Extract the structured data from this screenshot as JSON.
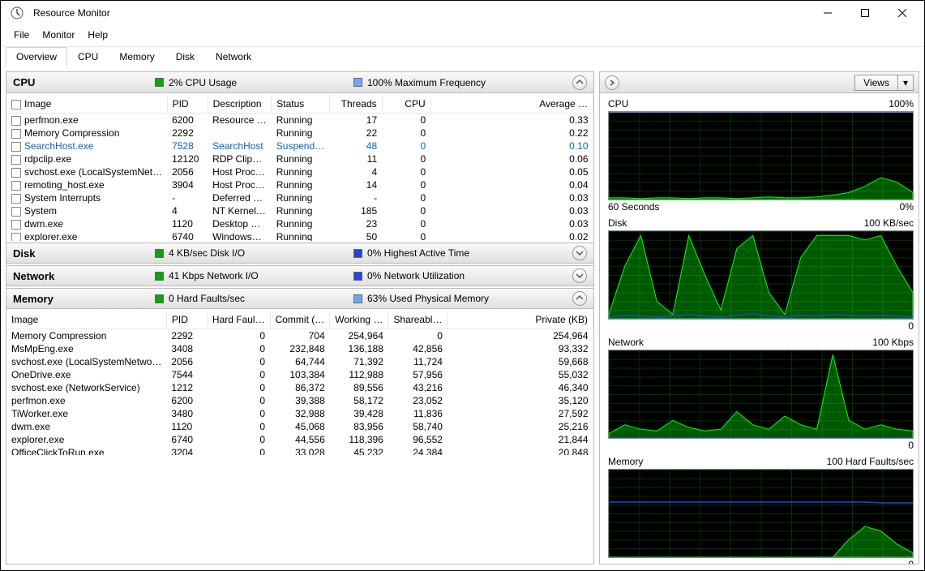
{
  "window": {
    "title": "Resource Monitor"
  },
  "menus": [
    "File",
    "Monitor",
    "Help"
  ],
  "tabs": [
    "Overview",
    "CPU",
    "Memory",
    "Disk",
    "Network"
  ],
  "active_tab": 0,
  "cpu_section": {
    "title": "CPU",
    "stat1": "2% CPU Usage",
    "stat1_color": "#00aa00",
    "stat2": "100% Maximum Frequency",
    "stat2_color": "#6aa8ff",
    "columns": [
      "Image",
      "PID",
      "Description",
      "Status",
      "Threads",
      "CPU",
      "Average …"
    ],
    "rows": [
      {
        "image": "perfmon.exe",
        "pid": "6200",
        "desc": "Resource …",
        "status": "Running",
        "threads": "17",
        "cpu": "0",
        "avg": "0.33"
      },
      {
        "image": "Memory Compression",
        "pid": "2292",
        "desc": "",
        "status": "Running",
        "threads": "22",
        "cpu": "0",
        "avg": "0.22"
      },
      {
        "image": "SearchHost.exe",
        "pid": "7528",
        "desc": "SearchHost",
        "status": "Suspend…",
        "threads": "48",
        "cpu": "0",
        "avg": "0.10",
        "suspended": true
      },
      {
        "image": "rdpclip.exe",
        "pid": "12120",
        "desc": "RDP Clip…",
        "status": "Running",
        "threads": "11",
        "cpu": "0",
        "avg": "0.06"
      },
      {
        "image": "svchost.exe (LocalSystemNet…",
        "pid": "2056",
        "desc": "Host Proc…",
        "status": "Running",
        "threads": "4",
        "cpu": "0",
        "avg": "0.05"
      },
      {
        "image": "remoting_host.exe",
        "pid": "3904",
        "desc": "Host Proc…",
        "status": "Running",
        "threads": "14",
        "cpu": "0",
        "avg": "0.04"
      },
      {
        "image": "System Interrupts",
        "pid": "-",
        "desc": "Deferred …",
        "status": "Running",
        "threads": "-",
        "cpu": "0",
        "avg": "0.03"
      },
      {
        "image": "System",
        "pid": "4",
        "desc": "NT Kernel…",
        "status": "Running",
        "threads": "185",
        "cpu": "0",
        "avg": "0.03"
      },
      {
        "image": "dwm.exe",
        "pid": "1120",
        "desc": "Desktop …",
        "status": "Running",
        "threads": "23",
        "cpu": "0",
        "avg": "0.03"
      },
      {
        "image": "explorer.exe",
        "pid": "6740",
        "desc": "Windows…",
        "status": "Running",
        "threads": "50",
        "cpu": "0",
        "avg": "0.02"
      }
    ]
  },
  "disk_section": {
    "title": "Disk",
    "stat1": "4 KB/sec Disk I/O",
    "stat1_color": "#00aa00",
    "stat2": "0% Highest Active Time",
    "stat2_color": "#2244dd"
  },
  "network_section": {
    "title": "Network",
    "stat1": "41 Kbps Network I/O",
    "stat1_color": "#00aa00",
    "stat2": "0% Network Utilization",
    "stat2_color": "#2244dd"
  },
  "memory_section": {
    "title": "Memory",
    "stat1": "0 Hard Faults/sec",
    "stat1_color": "#00aa00",
    "stat2": "63% Used Physical Memory",
    "stat2_color": "#6aa8ff",
    "columns": [
      "Image",
      "PID",
      "Hard Faul…",
      "Commit (…",
      "Working …",
      "Shareabl…",
      "Private (KB)"
    ],
    "rows": [
      {
        "image": "Memory Compression",
        "pid": "2292",
        "hf": "0",
        "commit": "704",
        "working": "254,964",
        "share": "0",
        "priv": "254,964"
      },
      {
        "image": "MsMpEng.exe",
        "pid": "3408",
        "hf": "0",
        "commit": "232,848",
        "working": "136,188",
        "share": "42,856",
        "priv": "93,332"
      },
      {
        "image": "svchost.exe (LocalSystemNetwo…",
        "pid": "2056",
        "hf": "0",
        "commit": "64,744",
        "working": "71,392",
        "share": "11,724",
        "priv": "59,668"
      },
      {
        "image": "OneDrive.exe",
        "pid": "7544",
        "hf": "0",
        "commit": "103,384",
        "working": "112,988",
        "share": "57,956",
        "priv": "55,032"
      },
      {
        "image": "svchost.exe (NetworkService)",
        "pid": "1212",
        "hf": "0",
        "commit": "86,372",
        "working": "89,556",
        "share": "43,216",
        "priv": "46,340"
      },
      {
        "image": "perfmon.exe",
        "pid": "6200",
        "hf": "0",
        "commit": "39,388",
        "working": "58,172",
        "share": "23,052",
        "priv": "35,120"
      },
      {
        "image": "TiWorker.exe",
        "pid": "3480",
        "hf": "0",
        "commit": "32,988",
        "working": "39,428",
        "share": "11,836",
        "priv": "27,592"
      },
      {
        "image": "dwm.exe",
        "pid": "1120",
        "hf": "0",
        "commit": "45,068",
        "working": "83,956",
        "share": "58,740",
        "priv": "25,216"
      },
      {
        "image": "explorer.exe",
        "pid": "6740",
        "hf": "0",
        "commit": "44,556",
        "working": "118,396",
        "share": "96,552",
        "priv": "21,844"
      },
      {
        "image": "OfficeClickToRun.exe",
        "pid": "3204",
        "hf": "0",
        "commit": "33,028",
        "working": "45,232",
        "share": "24,384",
        "priv": "20,848"
      }
    ]
  },
  "views_label": "Views",
  "charts": {
    "cpu": {
      "title": "CPU",
      "right": "100%",
      "footL": "60 Seconds",
      "footR": "0%"
    },
    "disk": {
      "title": "Disk",
      "right": "100 KB/sec",
      "footL": "",
      "footR": "0"
    },
    "network": {
      "title": "Network",
      "right": "100 Kbps",
      "footL": "",
      "footR": "0"
    },
    "memory": {
      "title": "Memory",
      "right": "100 Hard Faults/sec",
      "footL": "",
      "footR": "0"
    }
  },
  "chart_data": [
    {
      "type": "area",
      "title": "CPU",
      "xlabel": "60 Seconds",
      "ylabel": "",
      "ylim": [
        0,
        100
      ],
      "series": [
        {
          "name": "Maximum Frequency",
          "color": "#6aa8ff",
          "values": [
            100,
            100,
            100,
            100,
            100,
            100,
            100,
            100,
            100,
            100,
            100,
            100,
            100,
            100,
            100,
            100,
            100,
            100,
            100,
            100
          ]
        },
        {
          "name": "CPU Usage",
          "color": "#00ff00",
          "values": [
            2,
            2,
            1,
            2,
            2,
            1,
            2,
            2,
            1,
            2,
            3,
            2,
            2,
            3,
            5,
            8,
            15,
            25,
            20,
            8
          ]
        }
      ]
    },
    {
      "type": "area",
      "title": "Disk",
      "ylim": [
        0,
        100
      ],
      "series": [
        {
          "name": "Disk I/O",
          "color": "#00ff00",
          "values": [
            5,
            60,
            95,
            20,
            5,
            95,
            50,
            10,
            80,
            95,
            30,
            5,
            70,
            95,
            95,
            95,
            90,
            95,
            60,
            30
          ]
        },
        {
          "name": "Highest Active Time",
          "color": "#2244dd",
          "values": [
            2,
            4,
            3,
            2,
            3,
            5,
            3,
            2,
            4,
            6,
            3,
            2,
            4,
            3,
            5,
            4,
            3,
            4,
            3,
            2
          ]
        }
      ]
    },
    {
      "type": "area",
      "title": "Network",
      "ylim": [
        0,
        100
      ],
      "series": [
        {
          "name": "Network I/O",
          "color": "#00ff00",
          "values": [
            5,
            15,
            10,
            8,
            20,
            12,
            8,
            10,
            30,
            15,
            10,
            25,
            15,
            10,
            95,
            20,
            10,
            15,
            10,
            8
          ]
        },
        {
          "name": "Network Utilization",
          "color": "#2244dd",
          "values": [
            0,
            0,
            0,
            0,
            0,
            0,
            0,
            0,
            0,
            0,
            0,
            0,
            0,
            0,
            0,
            0,
            0,
            0,
            0,
            0
          ]
        }
      ]
    },
    {
      "type": "area",
      "title": "Memory",
      "ylim": [
        0,
        100
      ],
      "series": [
        {
          "name": "Used Physical Memory",
          "color": "#2244dd",
          "values": [
            63,
            63,
            63,
            63,
            63,
            63,
            63,
            63,
            63,
            63,
            63,
            63,
            63,
            63,
            63,
            63,
            63,
            62,
            62,
            62
          ]
        },
        {
          "name": "Hard Faults/sec",
          "color": "#00ff00",
          "values": [
            0,
            0,
            0,
            0,
            0,
            0,
            0,
            0,
            0,
            0,
            0,
            0,
            0,
            0,
            0,
            20,
            35,
            30,
            15,
            5
          ]
        }
      ]
    }
  ]
}
